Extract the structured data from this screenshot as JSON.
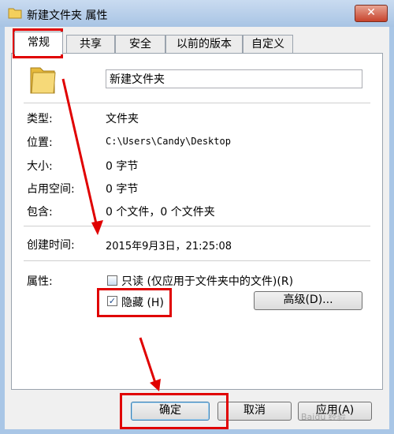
{
  "window": {
    "title": "新建文件夹 属性",
    "close_label": "✕"
  },
  "tabs": [
    {
      "label": "常规",
      "active": true
    },
    {
      "label": "共享",
      "active": false
    },
    {
      "label": "安全",
      "active": false
    },
    {
      "label": "以前的版本",
      "active": false
    },
    {
      "label": "自定义",
      "active": false
    }
  ],
  "general": {
    "folder_name": "新建文件夹",
    "type": {
      "label": "类型:",
      "value": "文件夹"
    },
    "location": {
      "label": "位置:",
      "value": "C:\\Users\\Candy\\Desktop"
    },
    "size": {
      "label": "大小:",
      "value": "0 字节"
    },
    "size_on_disk": {
      "label": "占用空间:",
      "value": "0 字节"
    },
    "contains": {
      "label": "包含:",
      "value": "0 个文件，0 个文件夹"
    },
    "created": {
      "label": "创建时间:",
      "value": "2015年9月3日，21:25:08"
    },
    "attributes": {
      "label": "属性:",
      "readonly_label": "只读 (仅应用于文件夹中的文件)(R)",
      "readonly_checked": false,
      "hidden_label": "隐藏 (H)",
      "hidden_checked": true,
      "hidden_check_glyph": "✓",
      "advanced_label": "高级(D)..."
    }
  },
  "buttons": {
    "ok_label": "确定",
    "cancel_label": "取消",
    "apply_label": "应用(A)"
  },
  "watermark": "Baidu 经验",
  "colors": {
    "annotation_red": "#e00000",
    "folder_yellow": "#f3cf5c"
  }
}
